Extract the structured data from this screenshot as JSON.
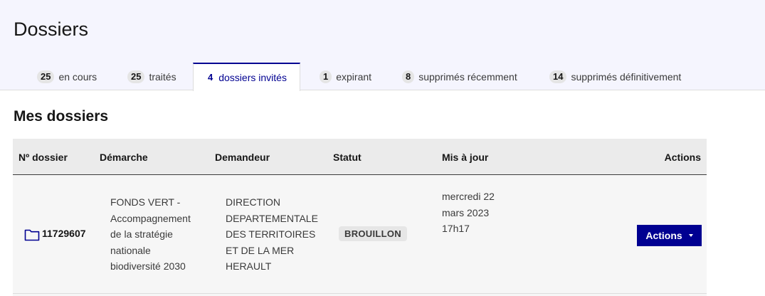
{
  "header": {
    "title": "Dossiers",
    "tabs": [
      {
        "count": "25",
        "label": "en cours"
      },
      {
        "count": "25",
        "label": "traités"
      },
      {
        "count": "4",
        "label": "dossiers invités"
      },
      {
        "count": "1",
        "label": "expirant"
      },
      {
        "count": "8",
        "label": "supprimés récemment"
      },
      {
        "count": "14",
        "label": "supprimés définitivement"
      }
    ],
    "active_tab": "dossiers invités"
  },
  "main": {
    "section_title": "Mes dossiers",
    "table": {
      "columns": [
        "Nº dossier",
        "Démarche",
        "Demandeur",
        "Statut",
        "Mis à jour",
        "Actions"
      ],
      "rows": [
        {
          "numero": "11729607",
          "demarche": [
            "FONDS VERT -",
            "Accompagnement",
            "de la stratégie",
            "nationale",
            "biodiversité 2030"
          ],
          "demandeur": [
            "DIRECTION",
            "DEPARTEMENTALE",
            "DES TERRITOIRES",
            "ET DE LA MER",
            "HERAULT"
          ],
          "statut": "BROUILLON",
          "mis_a_jour": [
            "mercredi 22",
            "mars 2023",
            "17h17"
          ],
          "action_label": "Actions"
        }
      ]
    }
  },
  "colors": {
    "accent": "#000091",
    "header_bg": "#f5f5fe",
    "table_bg": "#f6f6f6"
  },
  "icons": {
    "folder": "folder-icon",
    "caret": "caret-down-icon"
  }
}
